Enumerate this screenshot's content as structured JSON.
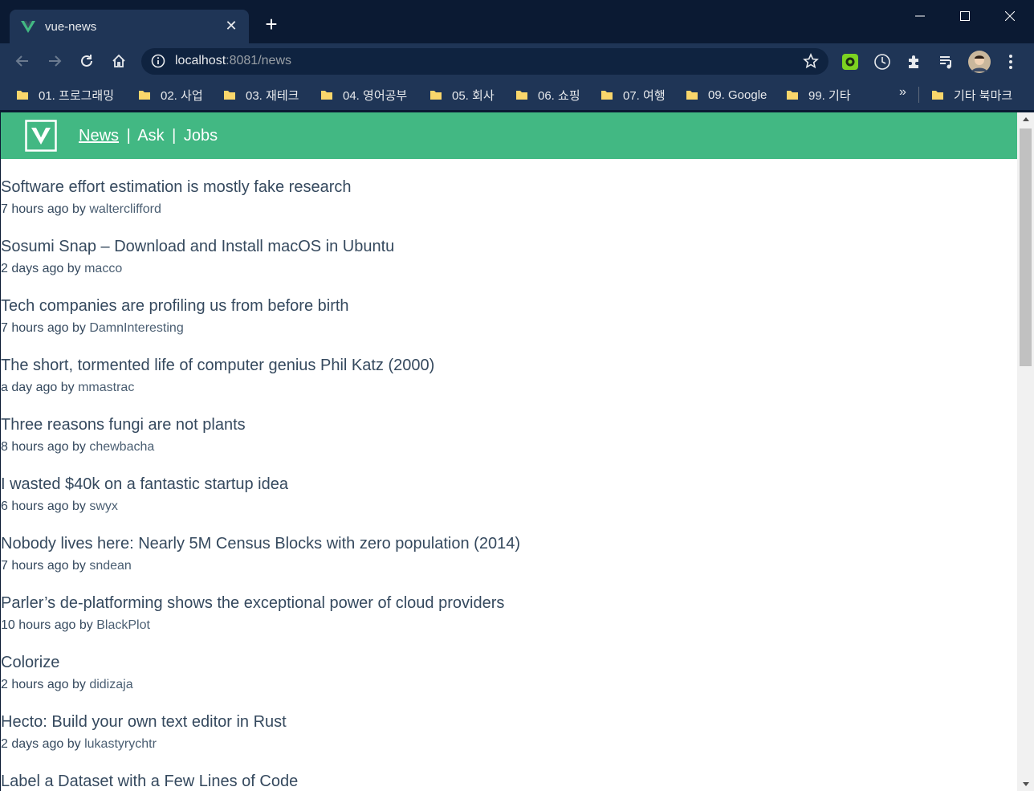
{
  "browser": {
    "tab_title": "vue-news",
    "url_host": "localhost",
    "url_rest": ":8081/news",
    "bookmarks": [
      "01. 프로그래밍",
      "02. 사업",
      "03. 재테크",
      "04. 영어공부",
      "05. 회사",
      "06. 쇼핑",
      "07. 여행",
      "09. Google",
      "99. 기타"
    ],
    "bookmarks_more": "»",
    "other_bookmarks": "기타 북마크"
  },
  "app": {
    "nav": {
      "news": "News",
      "ask": "Ask",
      "jobs": "Jobs",
      "separator": "|"
    },
    "accent_color": "#42b883",
    "text_color": "#35495e",
    "items": [
      {
        "title": "Software effort estimation is mostly fake research",
        "time": "7 hours ago",
        "by": "by",
        "user": "walterclifford"
      },
      {
        "title": "Sosumi Snap – Download and Install macOS in Ubuntu",
        "time": "2 days ago",
        "by": "by",
        "user": "macco"
      },
      {
        "title": "Tech companies are profiling us from before birth",
        "time": "7 hours ago",
        "by": "by",
        "user": "DamnInteresting"
      },
      {
        "title": "The short, tormented life of computer genius Phil Katz (2000)",
        "time": "a day ago",
        "by": "by",
        "user": "mmastrac"
      },
      {
        "title": "Three reasons fungi are not plants",
        "time": "8 hours ago",
        "by": "by",
        "user": "chewbacha"
      },
      {
        "title": "I wasted $40k on a fantastic startup idea",
        "time": "6 hours ago",
        "by": "by",
        "user": "swyx"
      },
      {
        "title": "Nobody lives here: Nearly 5M Census Blocks with zero population (2014)",
        "time": "7 hours ago",
        "by": "by",
        "user": "sndean"
      },
      {
        "title": "Parler’s de-platforming shows the exceptional power of cloud providers",
        "time": "10 hours ago",
        "by": "by",
        "user": "BlackPlot"
      },
      {
        "title": "Colorize",
        "time": "2 hours ago",
        "by": "by",
        "user": "didizaja"
      },
      {
        "title": "Hecto: Build your own text editor in Rust",
        "time": "2 days ago",
        "by": "by",
        "user": "lukastyrychtr"
      },
      {
        "title": "Label a Dataset with a Few Lines of Code",
        "time": "",
        "by": "",
        "user": ""
      }
    ]
  }
}
